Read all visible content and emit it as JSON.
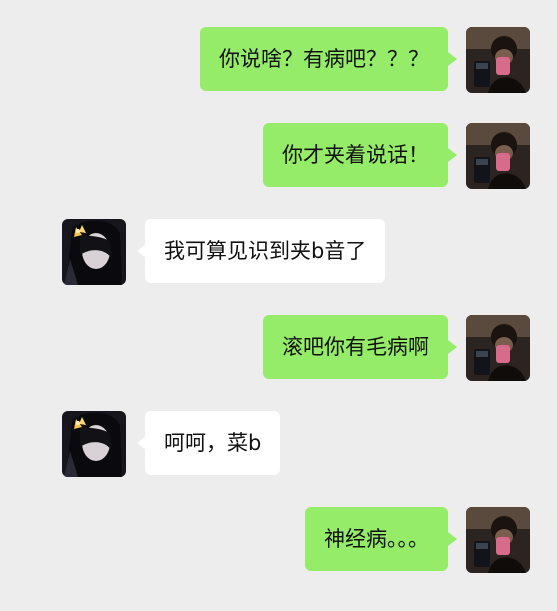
{
  "colors": {
    "background": "#ededed",
    "sent_bubble": "#95ec69",
    "received_bubble": "#ffffff",
    "text": "#111111"
  },
  "messages": [
    {
      "side": "right",
      "text": "你说啥？有病吧？？？"
    },
    {
      "side": "right",
      "text": "你才夹着说话！"
    },
    {
      "side": "left",
      "text": "我可算见识到夹b音了"
    },
    {
      "side": "right",
      "text": "滚吧你有毛病啊"
    },
    {
      "side": "left",
      "text": "呵呵，菜b"
    },
    {
      "side": "right",
      "text": "神经病。。。"
    }
  ]
}
